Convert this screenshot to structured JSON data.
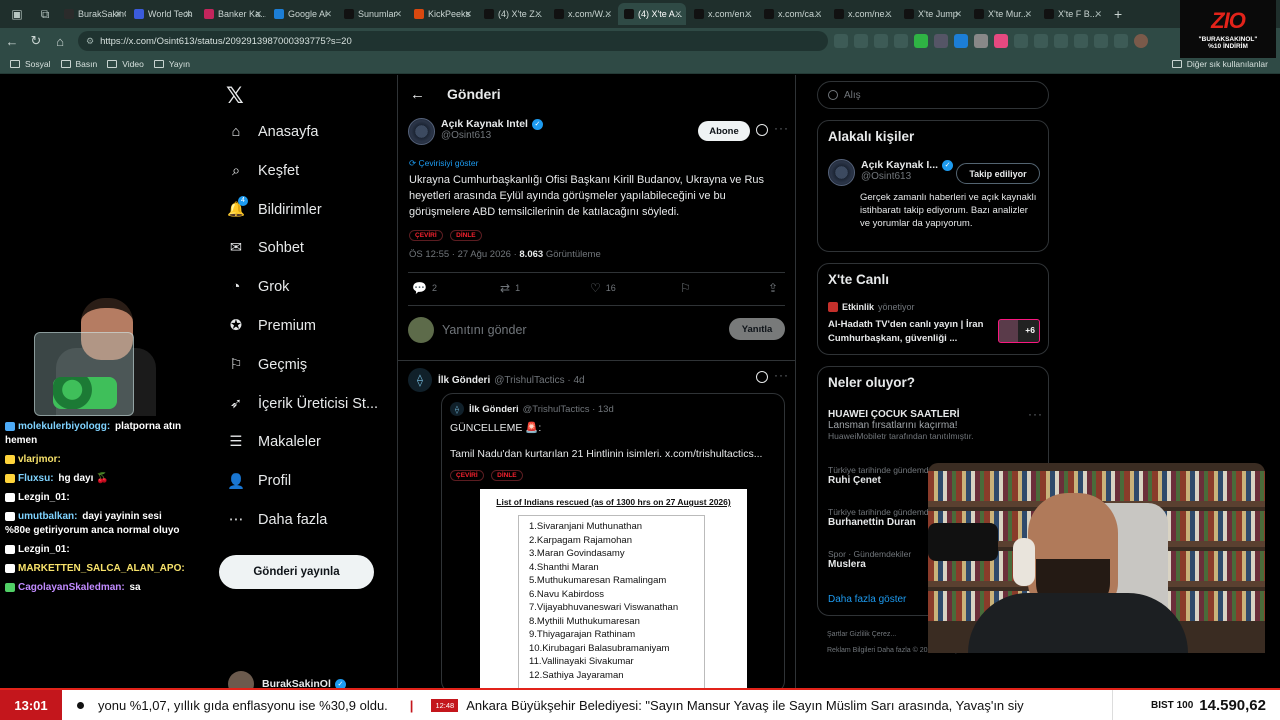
{
  "browser": {
    "tabs": [
      {
        "label": "BurakSakinOl",
        "color": "#2b2b2b",
        "active": false
      },
      {
        "label": "World Tech",
        "color": "#3b5bdb",
        "active": false
      },
      {
        "label": "Banker Ka...",
        "color": "#c2255c",
        "active": false
      },
      {
        "label": "Google Ai",
        "color": "#1c7ed6",
        "active": false
      },
      {
        "label": "Sunumlar",
        "color": "#111111",
        "active": false
      },
      {
        "label": "KickPeeks",
        "color": "#d9480f",
        "active": false
      },
      {
        "label": "(4) X'te Z...",
        "color": "#111111",
        "active": false
      },
      {
        "label": "x.com/W...",
        "color": "#111111",
        "active": false
      },
      {
        "label": "(4) X'te A...",
        "color": "#111111",
        "active": true
      },
      {
        "label": "x.com/en...",
        "color": "#111111",
        "active": false
      },
      {
        "label": "x.com/ca...",
        "color": "#111111",
        "active": false
      },
      {
        "label": "x.com/ne...",
        "color": "#111111",
        "active": false
      },
      {
        "label": "X'te Jump",
        "color": "#111111",
        "active": false
      },
      {
        "label": "X'te Mur...",
        "color": "#111111",
        "active": false
      },
      {
        "label": "X'te F B...",
        "color": "#111111",
        "active": false
      }
    ],
    "url": "https://x.com/Osint613/status/2092913987000393775?s=20",
    "bookmarks": [
      "Sosyal",
      "Basın",
      "Video",
      "Yayın"
    ],
    "bookmarks_right": "Diğer sık kullanılanlar"
  },
  "overlay_logo": {
    "mark": "ZIO",
    "line1": "\"BURAKSAKINOL\"",
    "line2": "%10 İNDİRİM"
  },
  "sidebar": {
    "items": [
      {
        "label": "Anasayfa",
        "icon": "home-icon"
      },
      {
        "label": "Keşfet",
        "icon": "search-icon"
      },
      {
        "label": "Bildirimler",
        "icon": "bell-icon",
        "badge": "4"
      },
      {
        "label": "Sohbet",
        "icon": "chat-icon"
      },
      {
        "label": "Grok",
        "icon": "grok-icon"
      },
      {
        "label": "Premium",
        "icon": "premium-icon"
      },
      {
        "label": "Geçmiş",
        "icon": "bookmark-icon"
      },
      {
        "label": "İçerik Üreticisi St...",
        "icon": "rocket-icon"
      },
      {
        "label": "Makaleler",
        "icon": "article-icon"
      },
      {
        "label": "Profil",
        "icon": "profile-icon"
      },
      {
        "label": "Daha fazla",
        "icon": "more-icon"
      }
    ],
    "post_button": "Gönderi yayınla",
    "account": "BurakSakinOl"
  },
  "post": {
    "header": "Gönderi",
    "author_name": "Açık Kaynak Intel",
    "author_handle": "@Osint613",
    "subscribe": "Abone",
    "show_translation": "Çevirisiyi göster",
    "text": "Ukrayna Cumhurbaşkanlığı Ofisi Başkanı Kirill Budanov, Ukrayna ve Rus heyetleri arasında Eylül ayında görüşmeler yapılabileceğini ve bu görüşmelere ABD temsilcilerinin de katılacağını söyledi.",
    "pill_translate": "ÇEVİRİ",
    "pill_listen": "DİNLE",
    "timestamp": "ÖS 12:55 · 27 Ağu 2026 ·",
    "views": "8.063",
    "views_label": "Görüntüleme",
    "replies": "2",
    "reposts": "1",
    "likes": "16",
    "reply_placeholder": "Yanıtını gönder",
    "reply_button": "Yanıtla"
  },
  "reply_post": {
    "name": "İlk Gönderi",
    "handle": "@TrishulTactics · 4d",
    "quote_name": "İlk Gönderi",
    "quote_handle": "@TrishulTactics · 13d",
    "quote_line1": "GÜNCELLEME 🚨:",
    "quote_line2": "Tamil Nadu'dan kurtarılan 21 Hintlinin isimleri.  x.com/trishultactics...",
    "doc_title": "List of Indians rescued (as of 1300 hrs on 27 August 2026)",
    "names": [
      "1.Sivaranjani Muthunathan",
      "2.Karpagam Rajamohan",
      "3.Maran Govindasamy",
      "4.Shanthi Maran",
      "5.Muthukumaresan Ramalingam",
      "6.Navu Kabirdoss",
      "7.Vijayabhuvaneswari Viswanathan",
      "8.Mythili Muthukumaresan",
      "9.Thiyagarajan Rathinam",
      "10.Kirubagari Balasubramaniyam",
      "11.Vallinayaki Sivakumar",
      "12.Sathiya Jayaraman"
    ]
  },
  "right": {
    "search_placeholder": "Alış",
    "related_title": "Alakalı kişiler",
    "related_name": "Açık Kaynak I...",
    "related_handle": "@Osint613",
    "following": "Takip ediliyor",
    "related_bio": "Gerçek zamanlı haberleri ve açık kaynaklı istihbaratı takip ediyorum. Bazı analizler ve yorumlar da yapıyorum.",
    "live_title": "X'te Canlı",
    "live_host": "Etkinlik",
    "live_role": "yönetiyor",
    "live_text": "Al-Hadath TV'den canlı yayın | İran Cumhurbaşkanı, güvenliği ...",
    "live_count": "+6",
    "trends_title": "Neler oluyor?",
    "promo_title": "HUAWEI ÇOCUK SAATLERİ",
    "promo_sub": "Lansman fırsatlarını kaçırma!",
    "promo_by": "HuaweiMobiletr tarafından tanıtılmıştır.",
    "trends": [
      {
        "context": "Türkiye tarihinde gündemde",
        "name": "Ruhi Çenet"
      },
      {
        "context": "Türkiye tarihinde gündemde",
        "name": "Burhanettin Duran"
      },
      {
        "context": "Spor · Gündemdekiler",
        "name": "Muslera"
      }
    ],
    "show_more": "Daha fazla göster",
    "footer1": "Şartlar    Gizlilik    Çerez...",
    "footer2": "Reklam Bilgileri    Daha fazla    © 2026 X Corp."
  },
  "chat": [
    {
      "user": "molekulerbiyologg:",
      "msg": "platporna atın hemen",
      "color": "#7fd3ff"
    },
    {
      "user": "vlarjmor:",
      "msg": "",
      "color": "#f7e26b"
    },
    {
      "user": "Fluxsu:",
      "msg": "hg dayı 🍒",
      "color": "#7fd3ff"
    },
    {
      "user": "Lezgin_01:",
      "msg": "",
      "color": "#ffffff"
    },
    {
      "user": "umutbalkan:",
      "msg": "dayi yayinin sesi %80e getiriyorum anca normal oluyo",
      "color": "#7fd3ff"
    },
    {
      "user": "Lezgin_01:",
      "msg": "",
      "color": "#ffffff"
    },
    {
      "user": "MARKETTEN_SALCA_ALAN_APO:",
      "msg": "",
      "color": "#f7e26b"
    },
    {
      "user": "CagolayanSkaledman:",
      "msg": "sa",
      "color": "#c18bff"
    }
  ],
  "ticker": {
    "time": "13:01",
    "news1": "yonu %1,07, yıllık gıda enflasyonu ise %30,9 oldu.",
    "news2_time": "12:48",
    "news2": "Ankara Büyükşehir Belediyesi: \"Sayın Mansur Yavaş ile Sayın Müslim Sarı arasında, Yavaş'ın siy",
    "bist_label": "BIST 100",
    "bist_value": "14.590,62"
  }
}
